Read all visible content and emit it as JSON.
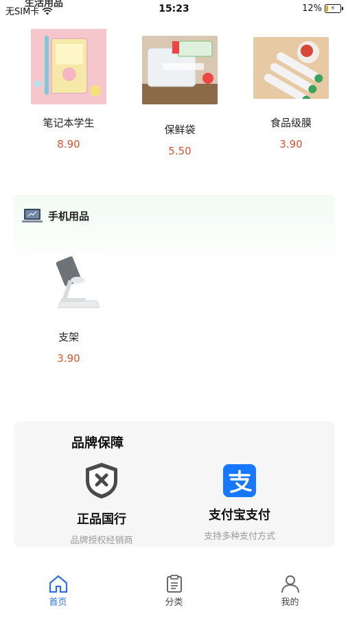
{
  "status_bar": {
    "carrier": "无SIM卡",
    "time": "15:23",
    "battery": "12%"
  },
  "sections": [
    {
      "title": "生活用品",
      "products": [
        {
          "name": "笔记本学生",
          "price": "8.90"
        },
        {
          "name": "保鲜袋",
          "price": "5.50"
        },
        {
          "name": "食品级膜",
          "price": "3.90"
        }
      ]
    },
    {
      "title": "手机用品",
      "products": [
        {
          "name": "支架",
          "price": "3.90"
        }
      ]
    }
  ],
  "brand": {
    "title": "品牌保障",
    "items": [
      {
        "label": "正品国行",
        "sub": "品牌授权经销商"
      },
      {
        "label": "支付宝支付",
        "sub": "支持多种支付方式"
      }
    ]
  },
  "nav": [
    {
      "label": "首页",
      "icon": "home-icon",
      "active": true
    },
    {
      "label": "分类",
      "icon": "clipboard-icon",
      "active": false
    },
    {
      "label": "我的",
      "icon": "user-icon",
      "active": false
    }
  ],
  "colors": {
    "price": "#d0542f",
    "active_nav": "#2f6fe0",
    "alipay": "#1677ff"
  }
}
